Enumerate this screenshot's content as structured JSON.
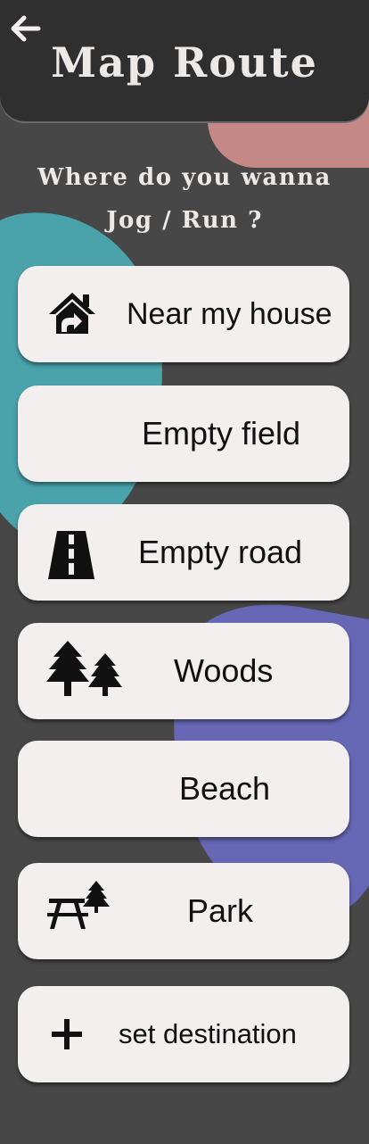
{
  "header": {
    "title": "Map Route",
    "back_icon": "arrow-left-icon"
  },
  "prompt": {
    "line1": "Where do you wanna",
    "line2": "Jog / Run ?"
  },
  "options": [
    {
      "label": "Near my house",
      "icon": "house-icon"
    },
    {
      "label": "Empty field",
      "icon": ""
    },
    {
      "label": "Empty road",
      "icon": "road-icon"
    },
    {
      "label": "Woods",
      "icon": "trees-icon"
    },
    {
      "label": "Beach",
      "icon": ""
    },
    {
      "label": "Park",
      "icon": "picnic-table-icon"
    },
    {
      "label": "set destination",
      "icon": "plus-icon"
    }
  ],
  "colors": {
    "background": "#474747",
    "header": "#2f2f2f",
    "button": "#f2efee",
    "blob_pink": "#c48886",
    "blob_teal": "#4aa2ab",
    "blob_purple": "#6667b5"
  }
}
